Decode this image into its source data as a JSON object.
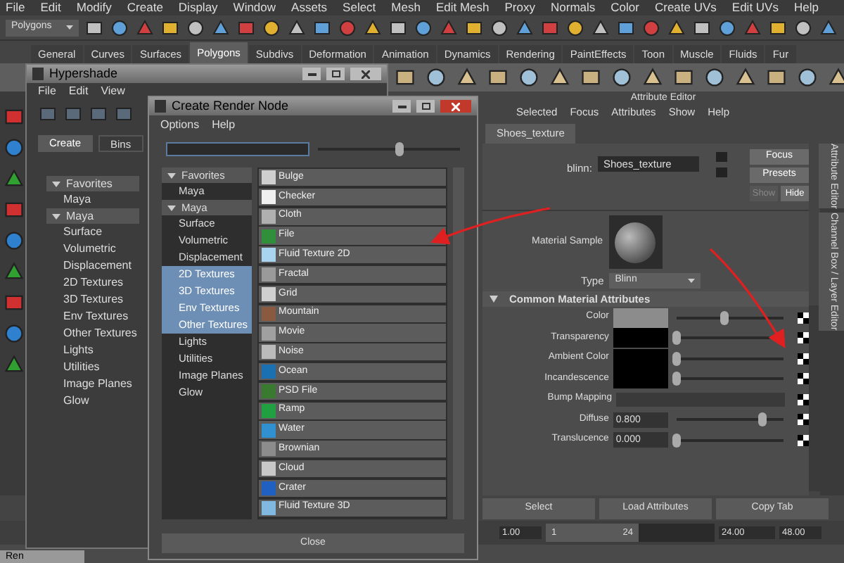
{
  "menu_bar": [
    "File",
    "Edit",
    "Modify",
    "Create",
    "Display",
    "Window",
    "Assets",
    "Select",
    "Mesh",
    "Edit Mesh",
    "Proxy",
    "Normals",
    "Color",
    "Create UVs",
    "Edit UVs",
    "Help"
  ],
  "toolbar": {
    "mode_dropdown": "Polygons"
  },
  "shelf": {
    "tabs": [
      {
        "label": "General",
        "selected": false
      },
      {
        "label": "Curves",
        "selected": false
      },
      {
        "label": "Surfaces",
        "selected": false
      },
      {
        "label": "Polygons",
        "selected": true
      },
      {
        "label": "Subdivs",
        "selected": false
      },
      {
        "label": "Deformation",
        "selected": false
      },
      {
        "label": "Animation",
        "selected": false
      },
      {
        "label": "Dynamics",
        "selected": false
      },
      {
        "label": "Rendering",
        "selected": false
      },
      {
        "label": "PaintEffects",
        "selected": false
      },
      {
        "label": "Toon",
        "selected": false
      },
      {
        "label": "Muscle",
        "selected": false
      },
      {
        "label": "Fluids",
        "selected": false
      },
      {
        "label": "Fur",
        "selected": false
      }
    ]
  },
  "hypershade": {
    "title": "Hypershade",
    "menu": [
      "File",
      "Edit",
      "View"
    ],
    "tabs": [
      {
        "label": "Create",
        "selected": true
      },
      {
        "label": "Bins",
        "selected": false
      }
    ],
    "tree": [
      {
        "label": "Favorites",
        "expanded": true,
        "children": [
          {
            "label": "Maya"
          }
        ]
      },
      {
        "label": "Maya",
        "expanded": true,
        "children": [
          {
            "label": "Surface"
          },
          {
            "label": "Volumetric"
          },
          {
            "label": "Displacement"
          },
          {
            "label": "2D Textures"
          },
          {
            "label": "3D Textures"
          },
          {
            "label": "Env Textures"
          },
          {
            "label": "Other Textures"
          },
          {
            "label": "Lights"
          },
          {
            "label": "Utilities"
          },
          {
            "label": "Image Planes"
          },
          {
            "label": "Glow"
          }
        ]
      }
    ]
  },
  "create_render_node": {
    "title": "Create Render Node",
    "menu": [
      "Options",
      "Help"
    ],
    "slider": {
      "level": 0.58
    },
    "tree": [
      {
        "label": "Favorites",
        "expanded": true,
        "children": [
          {
            "label": "Maya",
            "selected": false
          }
        ]
      },
      {
        "label": "Maya",
        "expanded": true,
        "children": [
          {
            "label": "Surface",
            "selected": false
          },
          {
            "label": "Volumetric",
            "selected": false
          },
          {
            "label": "Displacement",
            "selected": false
          },
          {
            "label": "2D Textures",
            "selected": true
          },
          {
            "label": "3D Textures",
            "selected": true
          },
          {
            "label": "Env Textures",
            "selected": true
          },
          {
            "label": "Other Textures",
            "selected": true
          },
          {
            "label": "Lights",
            "selected": false
          },
          {
            "label": "Utilities",
            "selected": false
          },
          {
            "label": "Image Planes",
            "selected": false
          },
          {
            "label": "Glow",
            "selected": false
          }
        ]
      }
    ],
    "nodes": [
      {
        "label": "Bulge",
        "color": "#cfcfcf"
      },
      {
        "label": "Checker",
        "color": "#f0f0f0"
      },
      {
        "label": "Cloth",
        "color": "#b0b0b0"
      },
      {
        "label": "File",
        "color": "#2f8f3a"
      },
      {
        "label": "Fluid Texture 2D",
        "color": "#a8d4f0"
      },
      {
        "label": "Fractal",
        "color": "#9a9a9a"
      },
      {
        "label": "Grid",
        "color": "#d0d0d0"
      },
      {
        "label": "Mountain",
        "color": "#8a5a40"
      },
      {
        "label": "Movie",
        "color": "#a0a0a0"
      },
      {
        "label": "Noise",
        "color": "#bbbbbb"
      },
      {
        "label": "Ocean",
        "color": "#1a70b0"
      },
      {
        "label": "PSD File",
        "color": "#3a7a30"
      },
      {
        "label": "Ramp",
        "color": "#20a040"
      },
      {
        "label": "Water",
        "color": "#3090d0"
      },
      {
        "label": "Brownian",
        "color": "#8c8c8c"
      },
      {
        "label": "Cloud",
        "color": "#c8c8c8"
      },
      {
        "label": "Crater",
        "color": "#2060c0"
      },
      {
        "label": "Fluid Texture 3D",
        "color": "#80b8e0"
      }
    ],
    "close_button": "Close"
  },
  "attribute_editor": {
    "title": "Attribute Editor",
    "menu": [
      "Selected",
      "Focus",
      "Attributes",
      "Show",
      "Help"
    ],
    "tab": "Shoes_texture",
    "name_label": "blinn:",
    "name_value": "Shoes_texture",
    "buttons": [
      {
        "label": "Focus",
        "disabled": false
      },
      {
        "label": "Presets",
        "disabled": false
      },
      {
        "label": "Show",
        "disabled": true
      },
      {
        "label": "Hide",
        "disabled": false
      }
    ],
    "sample_label": "Material Sample",
    "type_label": "Type",
    "type_value": "Blinn",
    "section": "Common Material Attributes",
    "attributes": [
      {
        "kind": "color",
        "label": "Color",
        "color": "#8c8c8c",
        "level": 0.45
      },
      {
        "kind": "color",
        "label": "Transparency",
        "color": "#000000",
        "level": 0
      },
      {
        "kind": "color",
        "label": "Ambient Color",
        "color": "#000000",
        "level": 0
      },
      {
        "kind": "color",
        "label": "Incandescence",
        "color": "#000000",
        "level": 0
      },
      {
        "kind": "map",
        "label": "Bump Mapping"
      },
      {
        "kind": "number",
        "label": "Diffuse",
        "value": "0.800",
        "level": 0.8
      },
      {
        "kind": "number",
        "label": "Translucence",
        "value": "0.000",
        "level": 0
      }
    ],
    "side_tabs": [
      "Attribute Editor",
      "Channel Box / Layer Editor"
    ],
    "bottom_buttons": [
      "Select",
      "Load Attributes",
      "Copy Tab"
    ]
  },
  "time_range": {
    "level": 0.55,
    "start": "1.00",
    "range_start": "1",
    "range_end": "24",
    "end": "24.00",
    "max": "48.00"
  },
  "minimized_window": {
    "title": "Ren"
  }
}
